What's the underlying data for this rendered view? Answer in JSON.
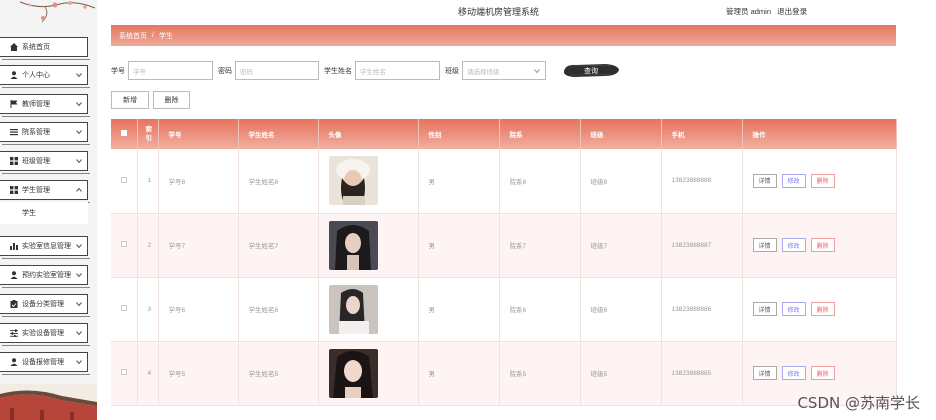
{
  "header": {
    "title": "移动端机房管理系统",
    "user_label": "管理员 admin",
    "logout_label": "退出登录"
  },
  "breadcrumb": {
    "home": "系统首页",
    "separator": "/",
    "current": "学生"
  },
  "sidebar": {
    "items": [
      {
        "label": "系统首页",
        "icon": "home-icon"
      },
      {
        "label": "个人中心",
        "icon": "user-icon"
      },
      {
        "label": "教师管理",
        "icon": "flag-icon"
      },
      {
        "label": "院系管理",
        "icon": "list-icon"
      },
      {
        "label": "班级管理",
        "icon": "grid-icon"
      },
      {
        "label": "学生管理",
        "icon": "grid-icon"
      },
      {
        "label": "实验室信息管理",
        "icon": "bar-chart-icon"
      },
      {
        "label": "预约实验室管理",
        "icon": "user-icon"
      },
      {
        "label": "设备分类管理",
        "icon": "clipboard-icon"
      },
      {
        "label": "实验设备管理",
        "icon": "sliders-icon"
      },
      {
        "label": "设备报修管理",
        "icon": "user-icon"
      }
    ],
    "submenu": "学生"
  },
  "search": {
    "student_no_label": "学号",
    "student_no_placeholder": "学号",
    "password_label": "密码",
    "password_placeholder": "密码",
    "name_label": "学生姓名",
    "name_placeholder": "学生姓名",
    "class_label": "班级",
    "class_placeholder": "请选择班级",
    "search_button": "查询"
  },
  "actions": {
    "add": "新增",
    "delete": "删除"
  },
  "table": {
    "headers": {
      "index": "索引",
      "student_no": "学号",
      "name": "学生姓名",
      "avatar": "头像",
      "gender": "性别",
      "department": "院系",
      "class": "班级",
      "phone": "手机",
      "ops": "操作"
    },
    "op_labels": {
      "detail": "详情",
      "edit": "修改",
      "delete": "删除"
    },
    "rows": [
      {
        "index": "1",
        "student_no": "学号8",
        "name": "学生姓名8",
        "gender": "男",
        "department": "院系8",
        "class": "班级8",
        "phone": "13823888888"
      },
      {
        "index": "2",
        "student_no": "学号7",
        "name": "学生姓名7",
        "gender": "男",
        "department": "院系7",
        "class": "班级7",
        "phone": "13823888887"
      },
      {
        "index": "3",
        "student_no": "学号6",
        "name": "学生姓名6",
        "gender": "男",
        "department": "院系6",
        "class": "班级6",
        "phone": "13823888886"
      },
      {
        "index": "4",
        "student_no": "学号5",
        "name": "学生姓名5",
        "gender": "男",
        "department": "院系5",
        "class": "班级5",
        "phone": "13823888885"
      }
    ]
  },
  "watermark": "CSDN @苏南学长",
  "colors": {
    "accent": "#e5735d",
    "accent_light": "#f1b0a2",
    "edit": "#7c7cf0",
    "delete": "#ee5f5f"
  }
}
